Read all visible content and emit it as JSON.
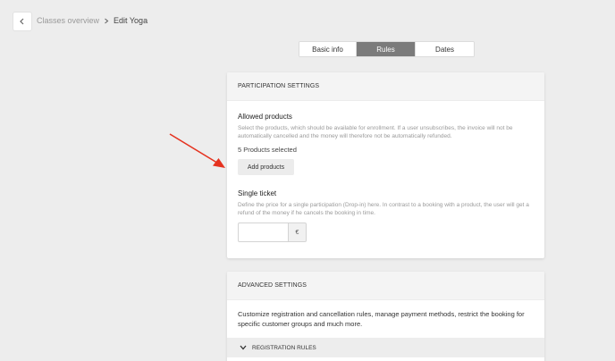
{
  "breadcrumb": {
    "back_icon": "chevron-left-icon",
    "parent": "Classes overview",
    "current": "Edit Yoga"
  },
  "tabs": [
    {
      "label": "Basic info",
      "active": false
    },
    {
      "label": "Rules",
      "active": true
    },
    {
      "label": "Dates",
      "active": false
    }
  ],
  "participation": {
    "header": "PARTICIPATION SETTINGS",
    "allowed_title": "Allowed products",
    "allowed_desc": "Select the products, which should be available for enrollment. If a user unsubscribes, the invoice will not be automatically cancelled and the money will therefore not be automatically refunded.",
    "selected_count": "5 Products selected",
    "add_button": "Add products",
    "single_title": "Single ticket",
    "single_desc": "Define the price for a single participation (Drop-in) here. In contrast to a booking with a product, the user will get a refund of the money if he cancels the booking in time.",
    "price_value": "",
    "currency": "€"
  },
  "advanced": {
    "header": "ADVANCED SETTINGS",
    "description": "Customize registration and cancellation rules, manage payment methods, restrict the booking for specific customer groups and much more.",
    "subsection": "REGISTRATION RULES"
  },
  "annotation": {
    "arrow_color": "#e5321f"
  }
}
